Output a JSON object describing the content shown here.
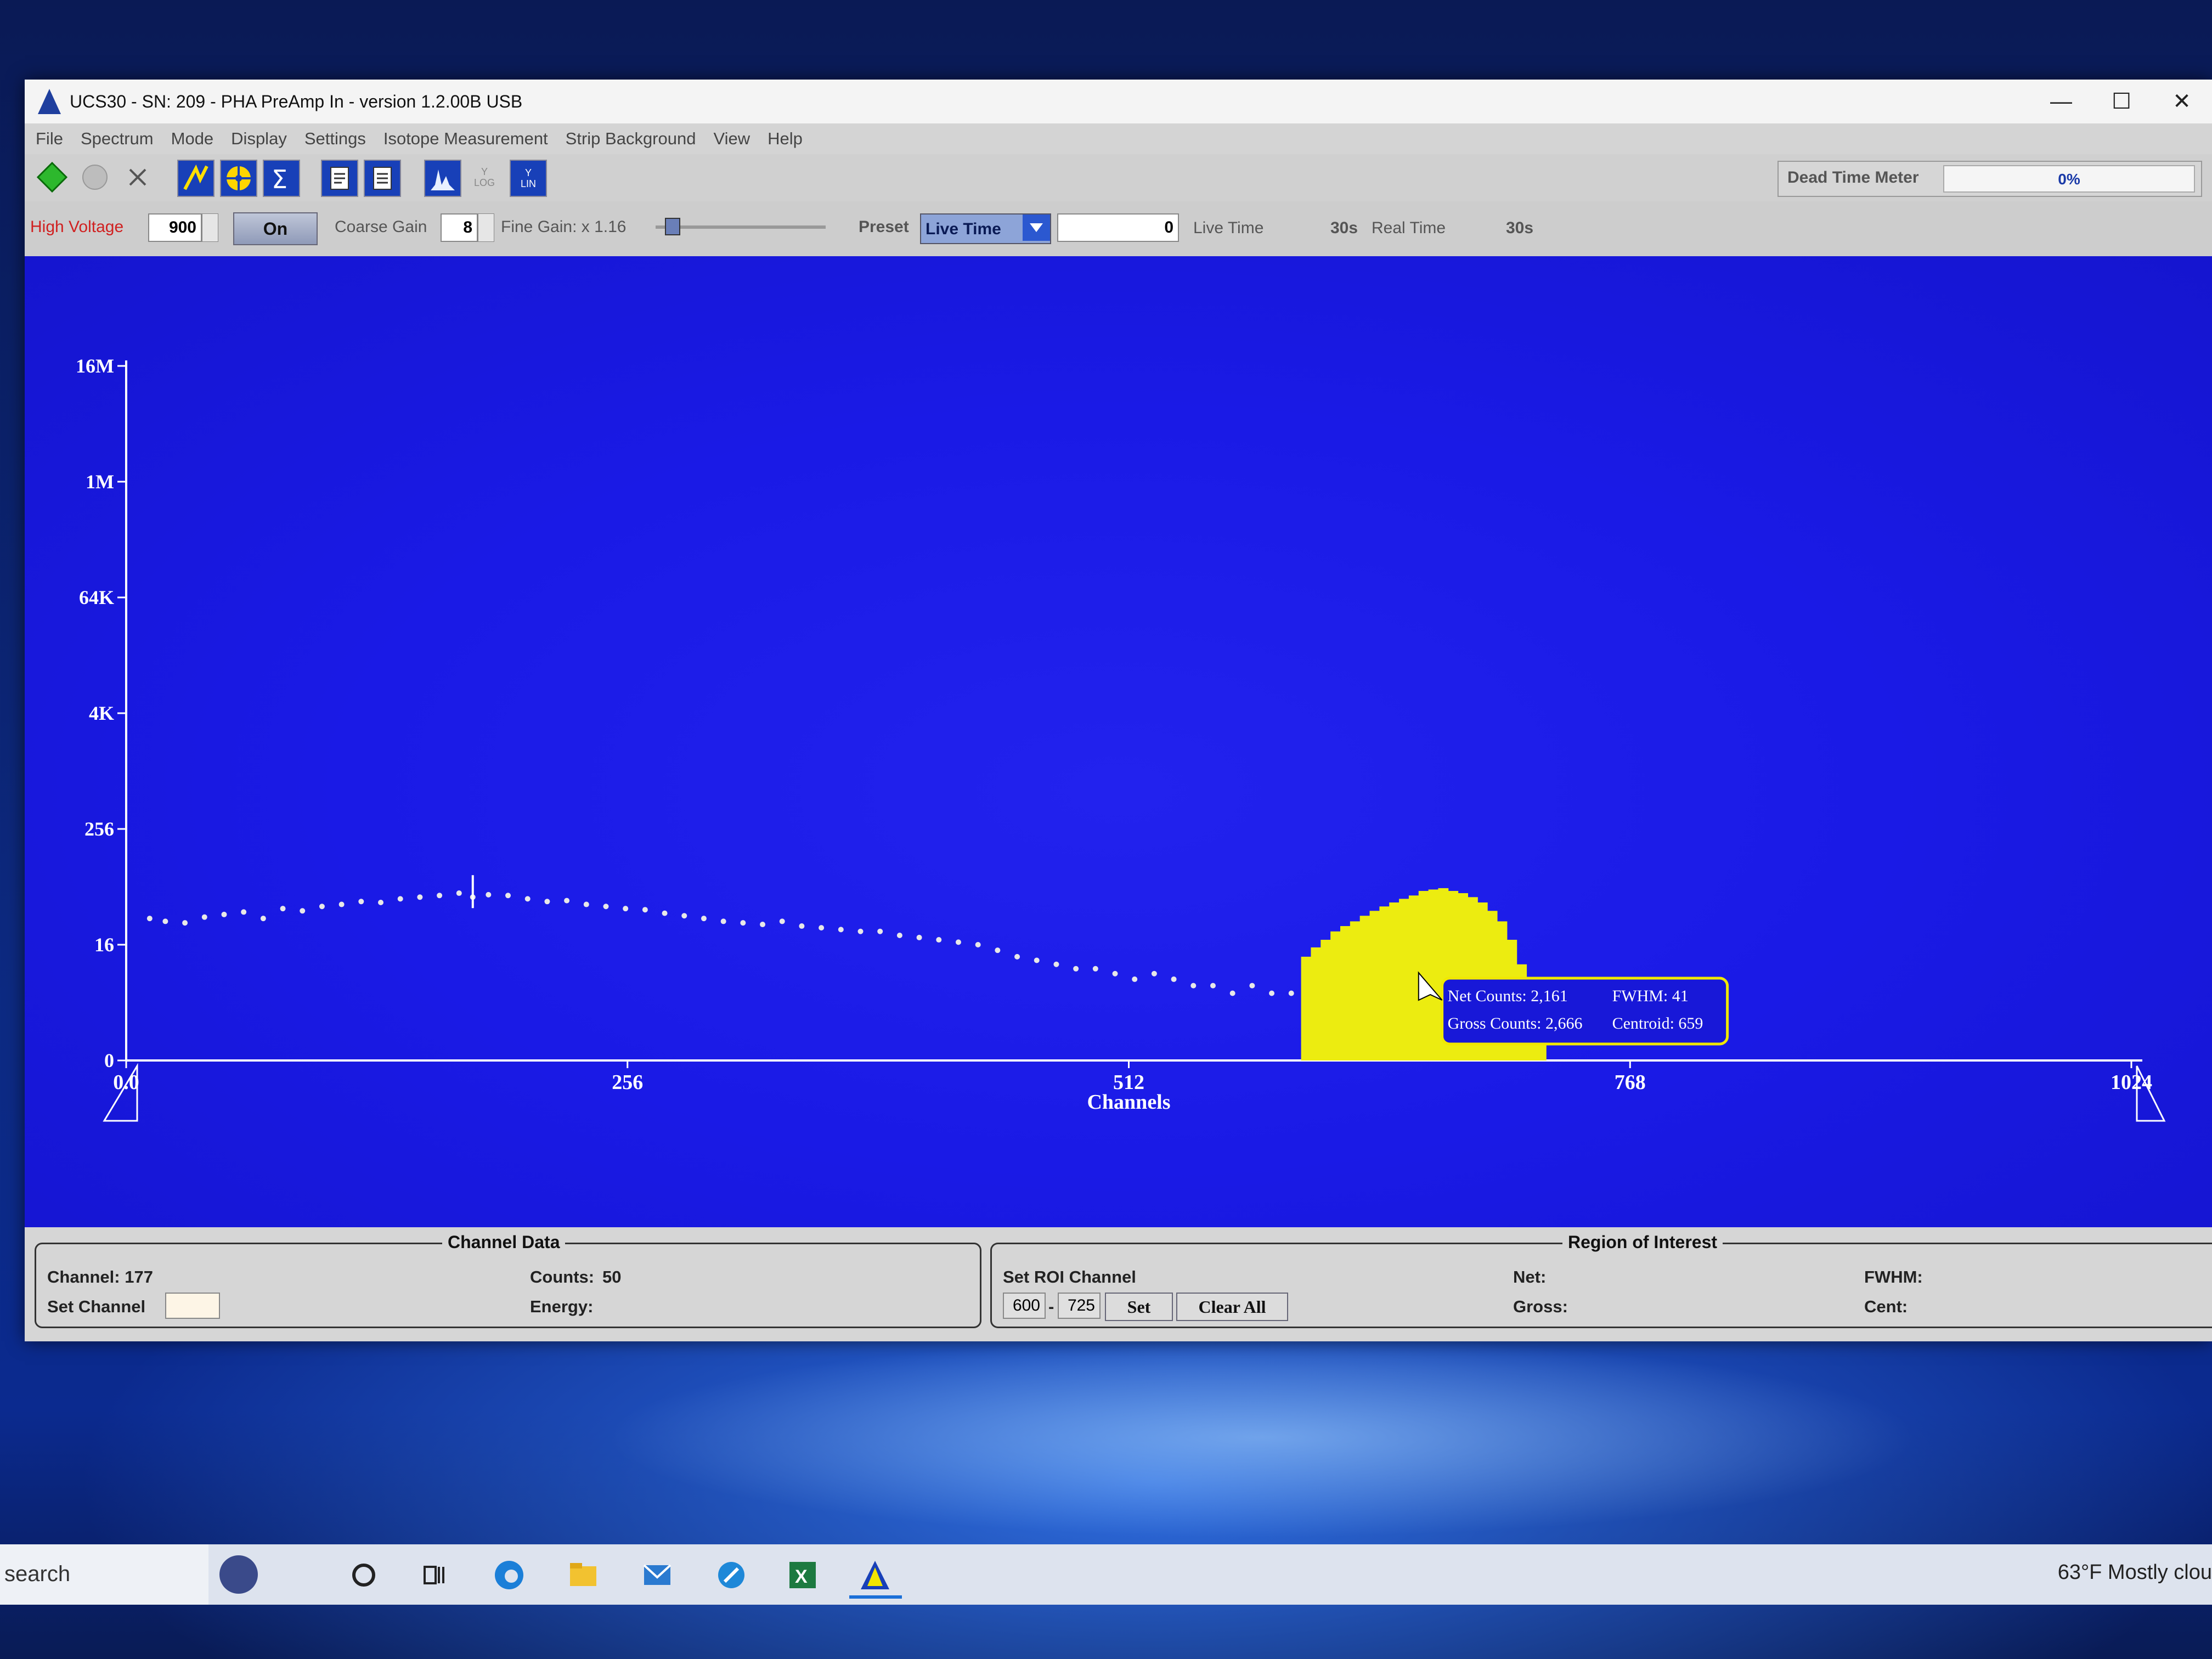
{
  "window": {
    "title": "UCS30 - SN: 209 - PHA PreAmp In  - version 1.2.00B USB",
    "controls": {
      "minimize": "—",
      "maximize": "☐",
      "close": "✕"
    }
  },
  "menu": [
    "File",
    "Spectrum",
    "Mode",
    "Display",
    "Settings",
    "Isotope Measurement",
    "Strip Background",
    "View",
    "Help"
  ],
  "toolbar": {
    "icons": [
      "start-icon",
      "stop-icon",
      "clear-icon",
      "calibrate-icon",
      "isotope-icon",
      "sum-icon",
      "open-file-icon",
      "save-file-icon",
      "spectrum-icon",
      "log-scale-icon",
      "lin-scale-icon"
    ],
    "log_label": "Y\nLOG",
    "lin_label": "Y\nLIN",
    "dead_time_label": "Dead Time Meter",
    "dead_time_value": "0%",
    "dead_time_fraction": 0
  },
  "controls": {
    "high_voltage_label": "High Voltage",
    "high_voltage_value": "900",
    "hv_button": "On",
    "coarse_gain_label": "Coarse Gain",
    "coarse_gain_value": "8",
    "fine_gain_label": "Fine Gain: x 1.16",
    "fine_gain_fraction": 0.1,
    "preset_label": "Preset",
    "preset_value": "Live Time",
    "preset_amount": "0",
    "live_time_label": "Live Time",
    "live_time_value": "30s",
    "real_time_label": "Real Time",
    "real_time_value": "30s"
  },
  "chart_data": {
    "type": "scatter",
    "xlabel": "Channels",
    "ylabel": "",
    "xlim": [
      0,
      1024
    ],
    "x_ticks": [
      "0.0",
      "256",
      "512",
      "768",
      "1024"
    ],
    "y_ticks": [
      "0",
      "16",
      "256",
      "4K",
      "64K",
      "1M",
      "16M"
    ],
    "y_scale": "log16",
    "cursor_channel": 177,
    "background_series": {
      "name": "",
      "color": "#e8e8e8",
      "x": [
        12,
        20,
        30,
        40,
        50,
        60,
        70,
        80,
        90,
        100,
        110,
        120,
        130,
        140,
        150,
        160,
        170,
        177,
        185,
        195,
        205,
        215,
        225,
        235,
        245,
        255,
        265,
        275,
        285,
        295,
        305,
        315,
        325,
        335,
        345,
        355,
        365,
        375,
        385,
        395,
        405,
        415,
        425,
        435,
        445,
        455,
        465,
        475,
        485,
        495,
        505,
        515,
        525,
        535,
        545,
        555,
        565,
        575,
        585,
        595
      ],
      "y": [
        30,
        28,
        27,
        31,
        33,
        35,
        30,
        38,
        36,
        40,
        42,
        45,
        44,
        48,
        50,
        52,
        55,
        50,
        53,
        52,
        48,
        45,
        46,
        42,
        40,
        38,
        37,
        34,
        32,
        30,
        28,
        27,
        26,
        28,
        25,
        24,
        23,
        22,
        22,
        20,
        19,
        18,
        17,
        16,
        14,
        12,
        11,
        10,
        9,
        9,
        8,
        7,
        8,
        7,
        6,
        6,
        5,
        6,
        5,
        5
      ]
    },
    "roi_series": {
      "name": "",
      "color": "#ecec10",
      "x": [
        600,
        605,
        610,
        615,
        620,
        625,
        630,
        635,
        640,
        645,
        650,
        655,
        660,
        665,
        670,
        675,
        680,
        685,
        690,
        695,
        700,
        705,
        710,
        715,
        720,
        725
      ],
      "y": [
        12,
        15,
        18,
        22,
        25,
        28,
        32,
        36,
        40,
        44,
        48,
        52,
        58,
        60,
        62,
        58,
        55,
        50,
        44,
        36,
        28,
        18,
        10,
        5,
        2,
        1
      ]
    },
    "tooltip": {
      "net_counts": "Net Counts: 2,161",
      "fwhm": "FWHM: 41",
      "gross_counts": "Gross Counts: 2,666",
      "centroid": "Centroid: 659"
    }
  },
  "status": {
    "channel_data_title": "Channel Data",
    "channel_label": "Channel: 177",
    "set_channel_label": "Set Channel",
    "set_channel_value": "",
    "counts_label": "Counts:",
    "counts_value": "50",
    "energy_label": "Energy:",
    "roi_title": "Region of Interest",
    "set_roi_label": "Set ROI Channel",
    "roi_start": "600",
    "roi_dash": "-",
    "roi_end": "725",
    "set_button": "Set",
    "clear_all_button": "Clear All",
    "net_label": "Net:",
    "gross_label": "Gross:",
    "fwhm_label": "FWHM:",
    "cent_label": "Cent:"
  },
  "taskbar": {
    "search_text": "search",
    "weather": "63°F  Mostly clou",
    "apps": [
      "cortana-icon",
      "task-view-icon",
      "edge-icon",
      "file-explorer-icon",
      "mail-icon",
      "settings-icon",
      "excel-icon",
      "ucs30-app-icon"
    ]
  }
}
